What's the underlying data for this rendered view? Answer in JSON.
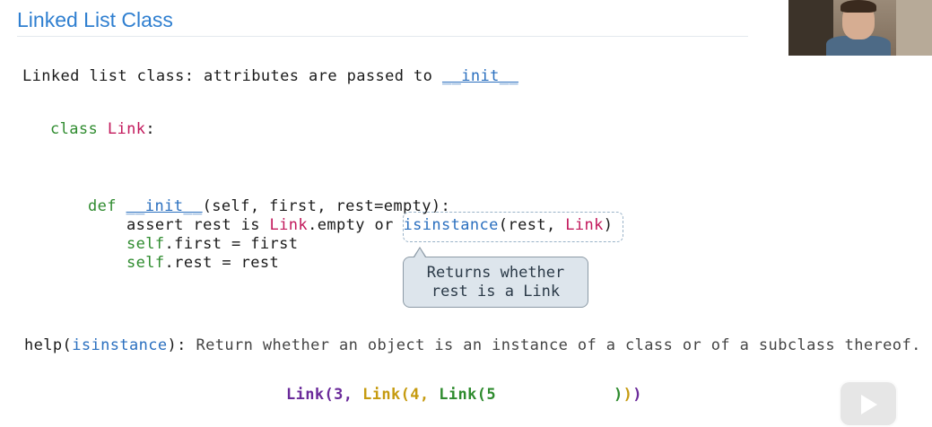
{
  "slide": {
    "title": "Linked List Class"
  },
  "intro": {
    "text": "Linked list class: attributes are passed to ",
    "init": "__init__"
  },
  "code": {
    "class_kw": "class ",
    "class_name": "Link",
    "class_colon": ":",
    "def_kw": "def ",
    "def_name": "__init__",
    "def_args": "(self, first, rest=empty):",
    "assert_prefix": "assert rest is ",
    "assert_link": "Link",
    "assert_mid": ".empty or ",
    "assert_isinstance": "isinstance",
    "assert_args_open": "(rest, ",
    "assert_link2": "Link",
    "assert_args_close": ")",
    "first_self": "self",
    "first_rest": ".first = first",
    "rest_self": "self",
    "rest_rest": ".rest = rest"
  },
  "tooltip": {
    "line1": "Returns whether",
    "line2": "rest is a Link"
  },
  "help": {
    "fn": "help",
    "open": "(",
    "arg": "isinstance",
    "close": "):",
    "desc": " Return whether an object is an instance of a class or of a subclass thereof."
  },
  "example": {
    "p1": "Link(3, ",
    "p2": "Link(4, ",
    "p3": "Link(5",
    "close1": ")",
    "close2": ")",
    "close3": ")"
  },
  "colors": {
    "title": "#2f7fd0",
    "keyword": "#2e8b2e",
    "class_name": "#c2185b",
    "builtin": "#2a6fbf"
  }
}
